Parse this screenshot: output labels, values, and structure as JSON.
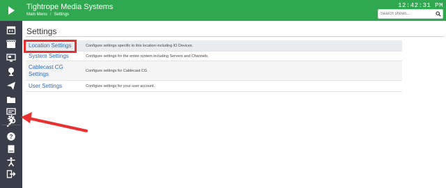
{
  "app": {
    "title": "Tightrope Media Systems",
    "clock": "12:42:31 PM"
  },
  "breadcrumb": {
    "items": [
      "Main Menu",
      "Settings"
    ],
    "separator": "/"
  },
  "search": {
    "placeholder": "Search shows..."
  },
  "page": {
    "title": "Settings"
  },
  "settings": [
    {
      "label": "Location Settings",
      "description": "Configure settings specific to this location including IO Devices."
    },
    {
      "label": "System Settings",
      "description": "Configure settings for the entire system including Servers and Channels."
    },
    {
      "label": "Cablecast CG Settings",
      "description": "Configure settings for Cablecast CG"
    },
    {
      "label": "User Settings",
      "description": "Configure settings for your user account."
    }
  ],
  "sidebar": {
    "icons": [
      "calendar-icon",
      "clapperboard-icon",
      "monitor-icon",
      "trophy-icon",
      "send-icon",
      "folder-icon",
      "screen-icon",
      "wrench-icon",
      "gear-icon",
      "help-icon",
      "book-icon",
      "accessibility-icon",
      "logout-icon"
    ]
  },
  "colors": {
    "brand": "#2fa84f",
    "sidebar": "#3a3e4a",
    "link": "#2e6db4",
    "annotation": "#e8312f"
  }
}
